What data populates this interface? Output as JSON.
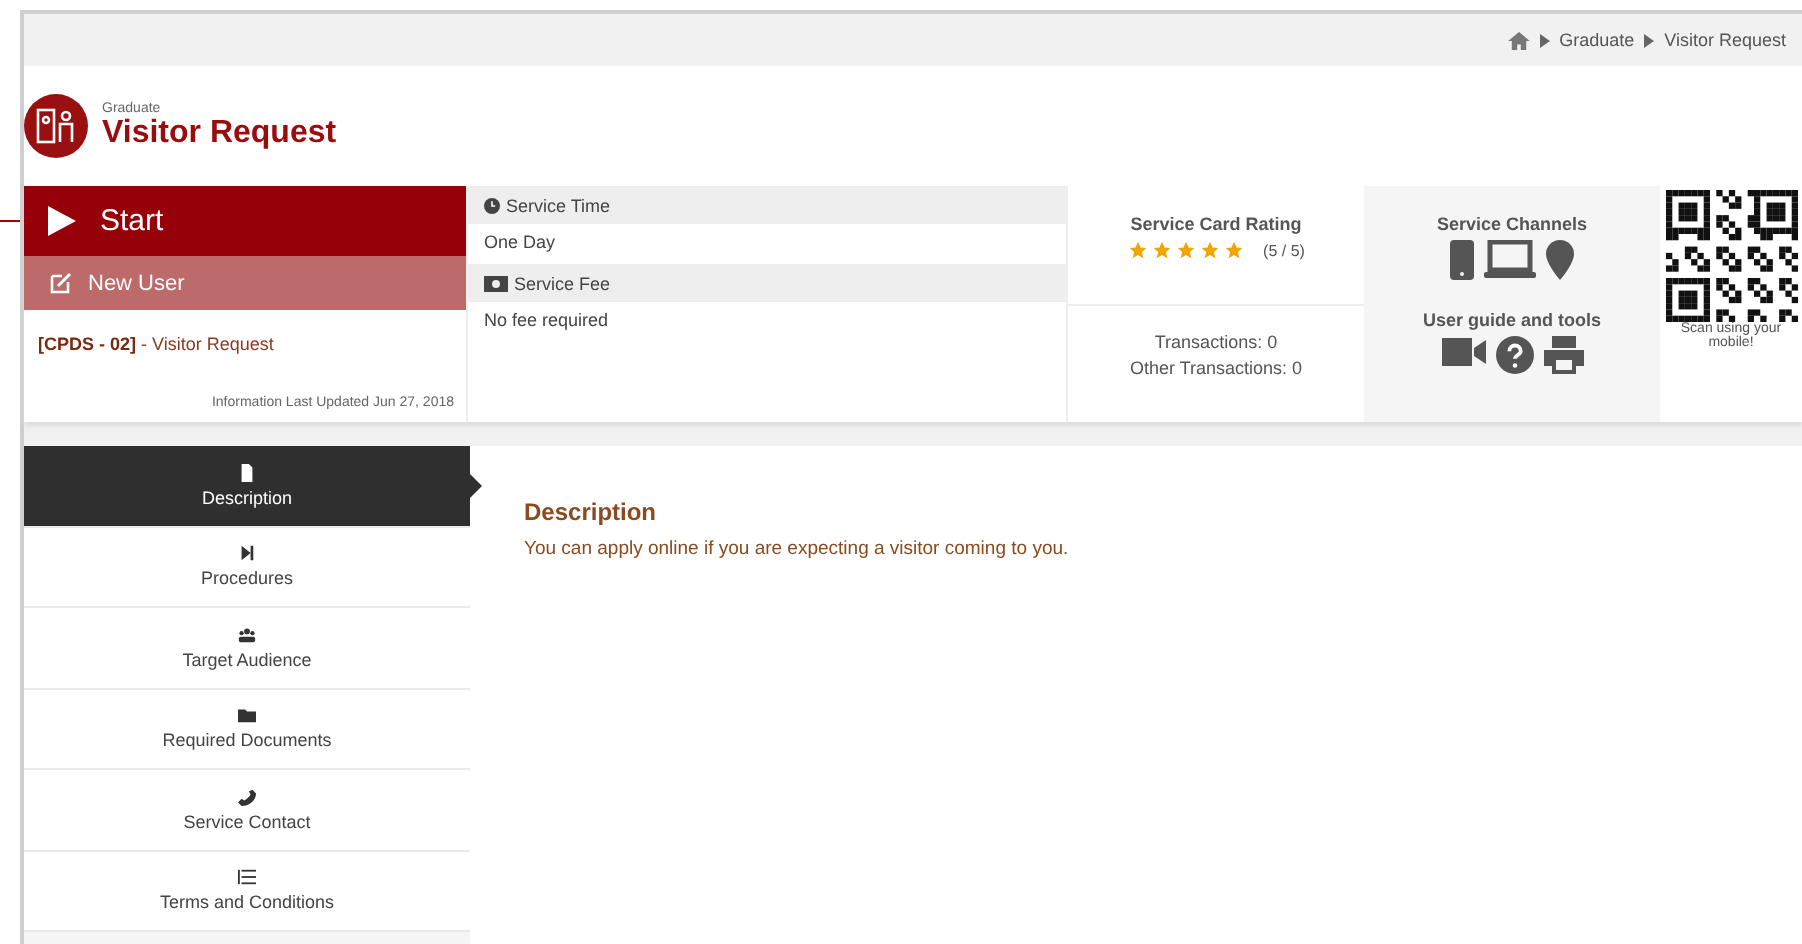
{
  "breadcrumb": [
    "Graduate",
    "Visitor Request"
  ],
  "header": {
    "category": "Graduate",
    "title": "Visitor Request"
  },
  "actions": {
    "start": "Start",
    "new_user": "New User"
  },
  "service_code": {
    "code": "[CPDS - 02]",
    "name": " - Visitor Request"
  },
  "updated": "Information Last Updated Jun 27, 2018",
  "service_time": {
    "label": "Service Time",
    "value": "One Day"
  },
  "service_fee": {
    "label": "Service Fee",
    "value": "No fee required"
  },
  "rating": {
    "title": "Service Card Rating",
    "stars": 5,
    "reading": "(5 / 5)"
  },
  "transactions": [
    "Transactions: 0",
    "Other Transactions: 0"
  ],
  "channels": {
    "title": "Service Channels",
    "tools_title": "User guide and tools"
  },
  "qr": {
    "caption": "Scan using your mobile!"
  },
  "tabs": [
    {
      "label": "Description",
      "selected": true
    },
    {
      "label": "Procedures",
      "selected": false
    },
    {
      "label": "Target Audience",
      "selected": false
    },
    {
      "label": "Required Documents",
      "selected": false
    },
    {
      "label": "Service Contact",
      "selected": false
    },
    {
      "label": "Terms and Conditions",
      "selected": false
    }
  ],
  "content": {
    "heading": "Description",
    "text": "You can apply online if you are expecting a visitor coming to you."
  }
}
